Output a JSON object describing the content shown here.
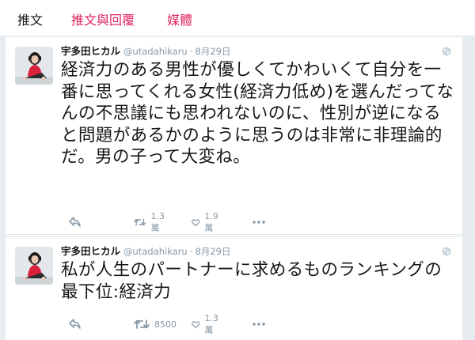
{
  "tabs": [
    {
      "label": "推文"
    },
    {
      "label": "推文與回覆"
    },
    {
      "label": "媒體"
    }
  ],
  "colors": {
    "link": "#e0245e",
    "muted": "#8899a6",
    "text": "#14171a",
    "background": "#e6ecf0"
  },
  "tweets": [
    {
      "name": "宇多田ヒカル",
      "handle": "@utadahikaru",
      "separator": "·",
      "time": "8月29日",
      "text": "経済力のある男性が優しくてかわいくて自分を一番に思ってくれる女性(経済力低め)を選んだってなんの不思議にも思われないのに、性別が逆になると問題があるかのように思うのは非常に非理論的だ。男の子って大変ね。",
      "retweets": "1.3萬",
      "likes": "1.9萬"
    },
    {
      "name": "宇多田ヒカル",
      "handle": "@utadahikaru",
      "separator": "·",
      "time": "8月29日",
      "text": "私が人生のパートナーに求めるものランキングの最下位:経済力",
      "retweets": "8500",
      "likes": "1.3萬"
    }
  ]
}
